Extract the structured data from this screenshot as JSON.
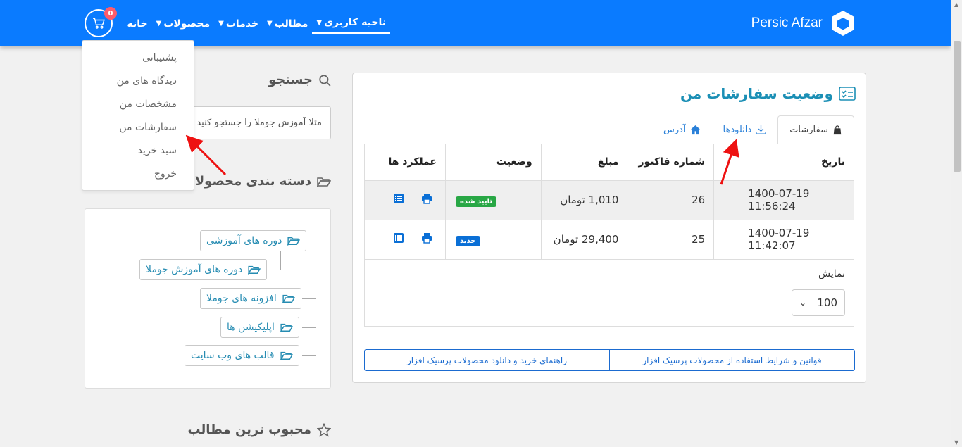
{
  "navbar": {
    "brand": "Persic Afzar",
    "items": [
      {
        "label": "خانه",
        "caret": false
      },
      {
        "label": "محصولات",
        "caret": true
      },
      {
        "label": "خدمات",
        "caret": true
      },
      {
        "label": "مطالب",
        "caret": true
      },
      {
        "label": "ناحیه کاربری",
        "caret": true,
        "active": true
      }
    ],
    "cart_count": "0"
  },
  "user_menu": {
    "items": [
      "پشتیبانی",
      "دیدگاه های من",
      "مشخصات من",
      "سفارشات من",
      "سبد خرید",
      "خروج"
    ]
  },
  "sidebar": {
    "search_title": "جستجو",
    "search_placeholder": "مثلا آموزش جوملا را جستجو کنید",
    "categories_title": "دسته بندی محصولات",
    "categories": [
      "دوره های آموزشی",
      "دوره های آموزش جوملا",
      "افزونه های جوملا",
      "اپلیکیشن ها",
      "قالب های وب سایت"
    ],
    "popular_title": "محبوب ترین مطالب"
  },
  "orders": {
    "title": "وضعیت سفارشات من",
    "tabs": [
      "سفارشات",
      "دانلودها",
      "آدرس"
    ],
    "columns": [
      "تاریخ",
      "شماره فاکتور",
      "مبلغ",
      "وضعیت",
      "عملکرد ها"
    ],
    "rows": [
      {
        "date": "1400-07-19 11:56:24",
        "invoice": "26",
        "amount": "1,010 تومان",
        "status": "تایید شده",
        "status_color": "#28a745"
      },
      {
        "date": "1400-07-19 11:42:07",
        "invoice": "25",
        "amount": "29,400 تومان",
        "status": "جدید",
        "status_color": "#0a6fd6"
      }
    ],
    "show_label": "نمایش",
    "page_size": "100",
    "footer_buttons": [
      "قوانین و شرایط استفاده از محصولات پرسیک افزار",
      "راهنمای خرید و دانلود محصولات پرسیک افزار"
    ]
  },
  "colors": {
    "accent": "#0a7bff",
    "title": "#1b8fb5"
  }
}
